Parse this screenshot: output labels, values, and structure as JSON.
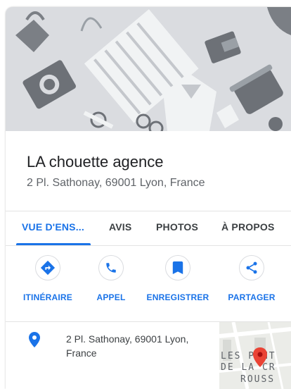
{
  "place": {
    "name": "LA chouette agence",
    "address": "2 Pl. Sathonay, 69001 Lyon, France"
  },
  "tabs": [
    {
      "label": "VUE D'ENS...",
      "active": true
    },
    {
      "label": "AVIS",
      "active": false
    },
    {
      "label": "PHOTOS",
      "active": false
    },
    {
      "label": "À PROPOS",
      "active": false
    }
  ],
  "actions": [
    {
      "label": "ITINÉRAIRE",
      "icon": "directions-icon"
    },
    {
      "label": "APPEL",
      "icon": "phone-icon"
    },
    {
      "label": "ENREGISTRER",
      "icon": "bookmark-icon"
    },
    {
      "label": "PARTAGER",
      "icon": "share-icon"
    }
  ],
  "address_row": {
    "text": "2 Pl. Sathonay, 69001 Lyon, France",
    "icon": "location-pin-icon"
  },
  "minimap": {
    "label_line1": "LES PENT",
    "label_line2": "DE LA CR",
    "label_line3": "ROUSS"
  },
  "colors": {
    "accent": "#1a73e8",
    "pin_red": "#ea4335",
    "text_primary": "#202124",
    "text_secondary": "#5f6368"
  }
}
